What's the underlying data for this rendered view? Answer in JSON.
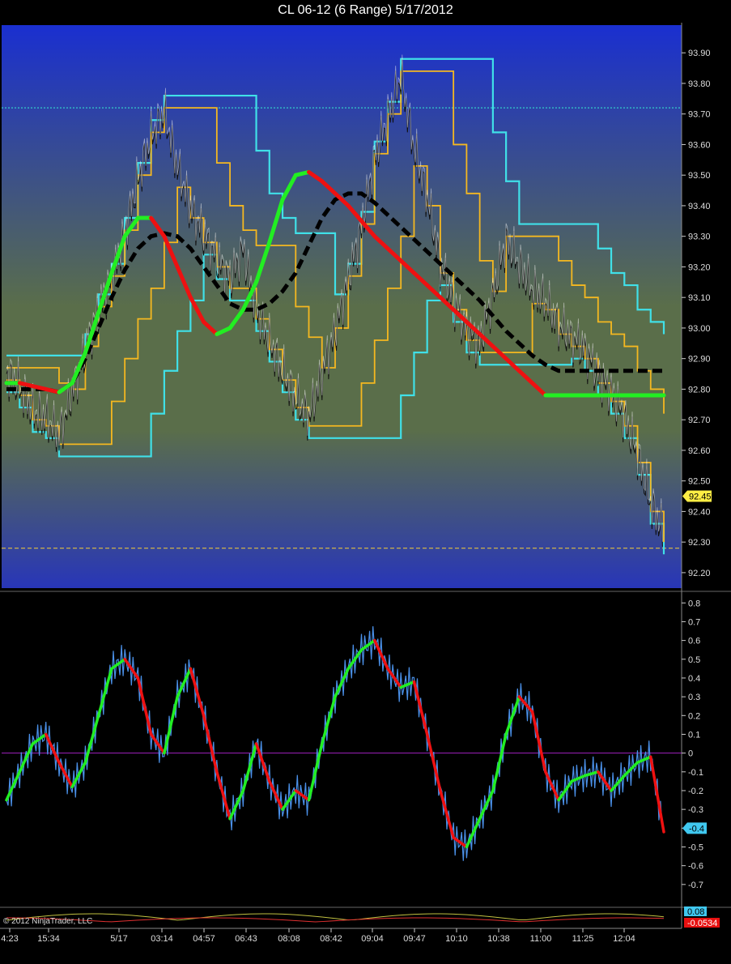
{
  "window": {
    "title": "CL 06-12 (6 Range)  5/17/2012"
  },
  "footer": {
    "copyright": "© 2012 NinjaTrader, LLC"
  },
  "colors": {
    "up": "#22ee22",
    "down": "#ee1111",
    "channel_outer": "#40e0e8",
    "channel_inner": "#f5b820",
    "last_price_badge": "#ffee44",
    "osc_badge": "#40c8f0",
    "vol_badge": "#e81010",
    "bg_top": "#1a2fd0",
    "bg_mid": "#5a6e4a",
    "bg_bottom": "#2836b8"
  },
  "chart_data": [
    {
      "type": "line",
      "title": "CL 06-12 (6 Range)  5/17/2012",
      "yticks": [
        "93.90",
        "93.80",
        "93.70",
        "93.60",
        "93.50",
        "93.40",
        "93.30",
        "93.20",
        "93.10",
        "93.00",
        "92.90",
        "92.80",
        "92.70",
        "92.60",
        "92.50",
        "92.40",
        "92.30",
        "92.20"
      ],
      "ylim": [
        92.16,
        93.98
      ],
      "last_price": "92.45",
      "hlines": [
        93.72,
        92.28
      ],
      "x": [
        0,
        2,
        4,
        6,
        8,
        10,
        12,
        14,
        16,
        18,
        20,
        22,
        24,
        26,
        28,
        30,
        32,
        34,
        36,
        38,
        40,
        42,
        44,
        46,
        48,
        50,
        52,
        54,
        56,
        58,
        60,
        62,
        64,
        66,
        68,
        70,
        72,
        74,
        76,
        78,
        80,
        82,
        84,
        86,
        88,
        90,
        92,
        94,
        96,
        98,
        100
      ],
      "series": [
        {
          "values": [
            92.85,
            92.8,
            92.72,
            92.7,
            92.64,
            92.78,
            92.92,
            93.05,
            93.15,
            93.3,
            93.48,
            93.62,
            93.7,
            93.52,
            93.38,
            93.3,
            93.22,
            93.15,
            93.25,
            93.05,
            92.95,
            92.85,
            92.76,
            92.7,
            92.84,
            92.98,
            93.15,
            93.32,
            93.55,
            93.68,
            93.82,
            93.58,
            93.42,
            93.2,
            93.08,
            92.98,
            92.94,
            93.1,
            93.28,
            93.2,
            93.12,
            93.08,
            93.0,
            92.96,
            92.92,
            92.84,
            92.78,
            92.7,
            92.58,
            92.42,
            92.32
          ]
        },
        {
          "values": [
            92.8,
            92.8,
            92.8,
            92.8,
            92.79,
            92.82,
            92.9,
            93.0,
            93.1,
            93.19,
            93.26,
            93.3,
            93.31,
            93.3,
            93.26,
            93.2,
            93.14,
            93.08,
            93.06,
            93.06,
            93.08,
            93.12,
            93.18,
            93.27,
            93.36,
            93.42,
            93.44,
            93.44,
            93.41,
            93.37,
            93.33,
            93.29,
            93.25,
            93.21,
            93.17,
            93.13,
            93.09,
            93.04,
            92.99,
            92.95,
            92.91,
            92.88,
            92.86,
            92.86,
            92.86,
            92.86,
            92.86,
            92.86,
            92.86,
            92.86,
            92.86
          ]
        },
        {
          "values": [
            92.82,
            92.82,
            92.81,
            92.8,
            92.79,
            92.82,
            92.92,
            93.05,
            93.18,
            93.3,
            93.36,
            93.36,
            93.3,
            93.2,
            93.1,
            93.02,
            92.98,
            93.0,
            93.06,
            93.15,
            93.28,
            93.42,
            93.5,
            93.51,
            93.48,
            93.44,
            93.4,
            93.35,
            93.3,
            93.26,
            93.22,
            93.18,
            93.14,
            93.1,
            93.06,
            93.02,
            92.98,
            92.94,
            92.9,
            92.86,
            92.82,
            92.78,
            92.78,
            92.78,
            92.78,
            92.78,
            92.78,
            92.78,
            92.78,
            92.78,
            92.78
          ]
        }
      ]
    },
    {
      "type": "line",
      "yticks": [
        "0.8",
        "0.7",
        "0.6",
        "0.5",
        "0.4",
        "0.3",
        "0.2",
        "0.1",
        "0",
        "-0.1",
        "-0.2",
        "-0.3",
        "-0.4",
        "-0.5",
        "-0.6",
        "-0.7"
      ],
      "ylim": [
        -0.8,
        0.84
      ],
      "last_value": "-0.4",
      "zero_line": 0,
      "x": [
        0,
        2,
        4,
        6,
        8,
        10,
        12,
        14,
        16,
        18,
        20,
        22,
        24,
        26,
        28,
        30,
        32,
        34,
        36,
        38,
        40,
        42,
        44,
        46,
        48,
        50,
        52,
        54,
        56,
        58,
        60,
        62,
        64,
        66,
        68,
        70,
        72,
        74,
        76,
        78,
        80,
        82,
        84,
        86,
        88,
        90,
        92,
        94,
        96,
        98,
        100
      ],
      "series": [
        {
          "values": [
            -0.25,
            -0.1,
            0.05,
            0.1,
            -0.05,
            -0.18,
            -0.05,
            0.2,
            0.45,
            0.5,
            0.4,
            0.1,
            0.0,
            0.3,
            0.45,
            0.2,
            -0.1,
            -0.35,
            -0.2,
            0.05,
            -0.15,
            -0.3,
            -0.2,
            -0.25,
            0.05,
            0.3,
            0.45,
            0.55,
            0.6,
            0.45,
            0.35,
            0.38,
            0.1,
            -0.2,
            -0.45,
            -0.5,
            -0.35,
            -0.2,
            0.1,
            0.3,
            0.22,
            -0.1,
            -0.25,
            -0.15,
            -0.12,
            -0.1,
            -0.2,
            -0.12,
            -0.05,
            -0.02,
            -0.42
          ]
        }
      ]
    },
    {
      "type": "line",
      "xticks": [
        "4:23",
        "15:34",
        "5/17",
        "03:14",
        "04:57",
        "06:43",
        "08:08",
        "08:42",
        "09:04",
        "09:47",
        "10:10",
        "10:38",
        "11:00",
        "11:25",
        "12:04"
      ],
      "last_values": [
        "0.08",
        "-0.0534"
      ]
    }
  ]
}
